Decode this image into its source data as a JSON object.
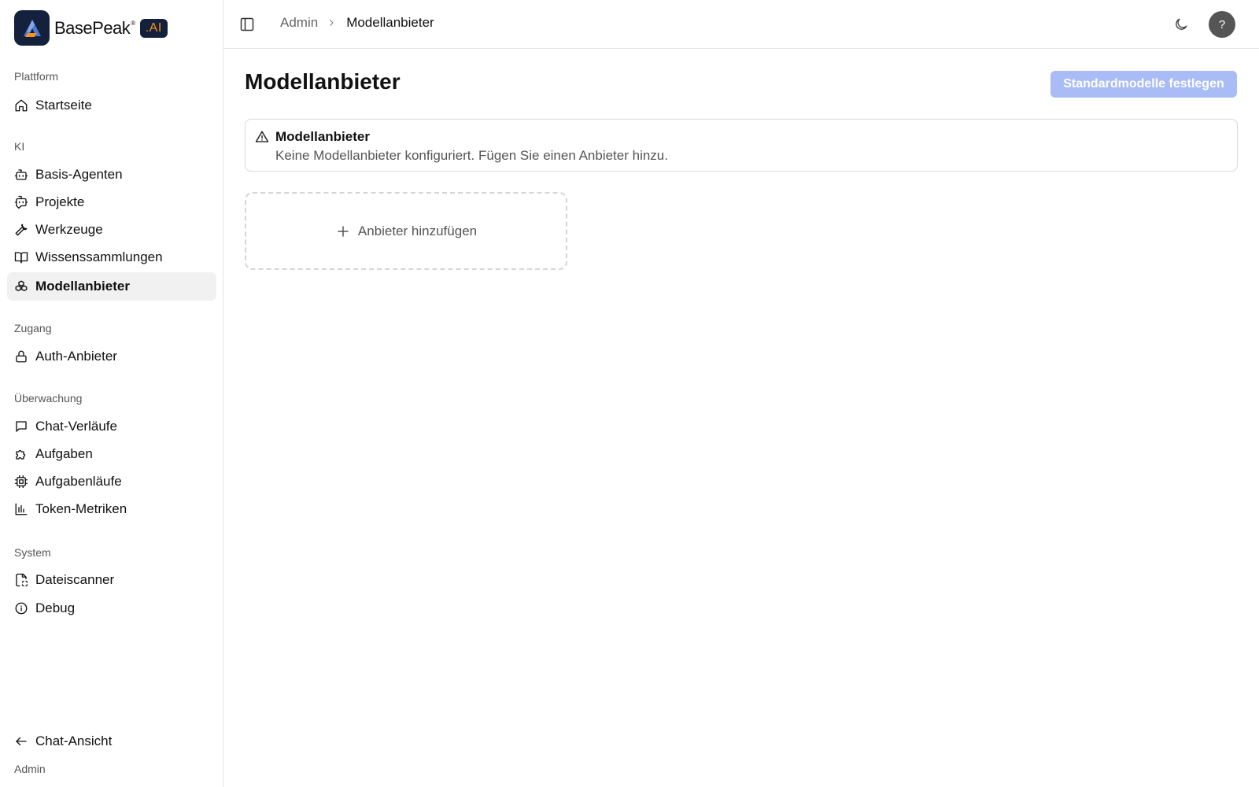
{
  "brand": {
    "name": "BasePeak",
    "registered": "®",
    "suffix": ".AI"
  },
  "sidebar": {
    "sections": [
      {
        "label": "Plattform",
        "items": [
          {
            "label": "Startseite",
            "icon": "home-icon"
          }
        ]
      },
      {
        "label": "KI",
        "items": [
          {
            "label": "Basis-Agenten",
            "icon": "bot-icon"
          },
          {
            "label": "Projekte",
            "icon": "bot-message-icon"
          },
          {
            "label": "Werkzeuge",
            "icon": "wrench-icon"
          },
          {
            "label": "Wissenssammlungen",
            "icon": "book-open-icon"
          },
          {
            "label": "Modellanbieter",
            "icon": "boxes-icon",
            "active": true
          }
        ]
      },
      {
        "label": "Zugang",
        "items": [
          {
            "label": "Auth-Anbieter",
            "icon": "lock-icon"
          }
        ]
      },
      {
        "label": "Überwachung",
        "items": [
          {
            "label": "Chat-Verläufe",
            "icon": "message-square-icon"
          },
          {
            "label": "Aufgaben",
            "icon": "puzzle-icon"
          },
          {
            "label": "Aufgabenläufe",
            "icon": "cpu-icon"
          },
          {
            "label": "Token-Metriken",
            "icon": "bar-chart-icon"
          }
        ]
      },
      {
        "label": "System",
        "items": [
          {
            "label": "Dateiscanner",
            "icon": "file-scan-icon"
          },
          {
            "label": "Debug",
            "icon": "info-icon"
          }
        ]
      }
    ],
    "footer": {
      "chat_view_label": "Chat-Ansicht",
      "chat_view_icon": "arrow-left-icon",
      "role_label": "Admin"
    }
  },
  "topbar": {
    "toggle_icon": "panel-left-icon",
    "breadcrumb": {
      "parent": "Admin",
      "current": "Modellanbieter"
    },
    "theme_icon": "moon-icon",
    "help_label": "?"
  },
  "main": {
    "title": "Modellanbieter",
    "primary_button_label": "Standardmodelle festlegen",
    "alert": {
      "icon": "alert-triangle-icon",
      "title": "Modellanbieter",
      "description": "Keine Modellanbieter konfiguriert. Fügen Sie einen Anbieter hinzu."
    },
    "add_card": {
      "icon": "plus-icon",
      "label": "Anbieter hinzufügen"
    }
  },
  "colors": {
    "brand_dark": "#14213d",
    "brand_accent": "#f7931e",
    "primary_disabled": "#a9bcf5",
    "active_nav_bg": "#f1f1f1"
  }
}
